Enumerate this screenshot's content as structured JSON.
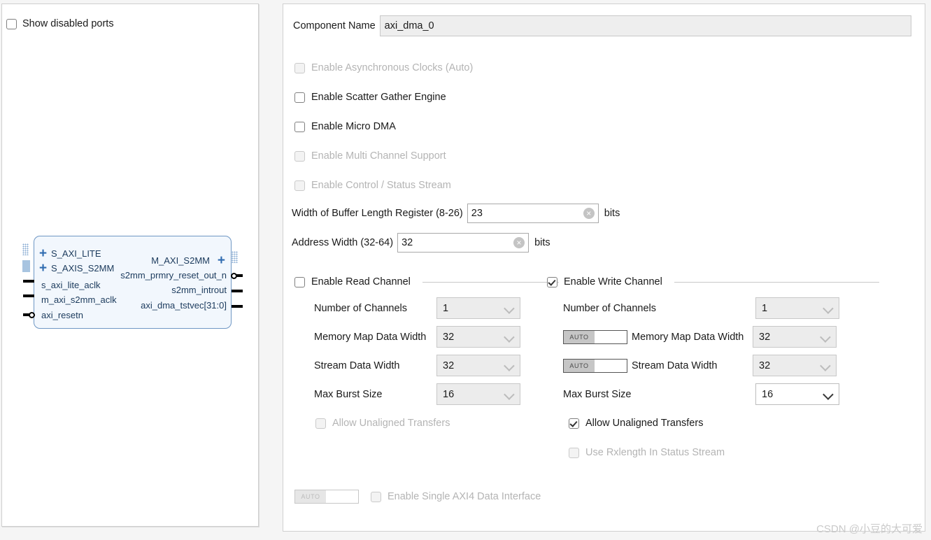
{
  "left_panel": {
    "show_disabled_ports": {
      "label": "Show disabled ports",
      "checked": false
    },
    "diagram": {
      "name": "axi_dma_0-block-symbol",
      "left_bus_ports": [
        "S_AXI_LITE",
        "S_AXIS_S2MM"
      ],
      "left_signal_ports": [
        "s_axi_lite_aclk",
        "m_axi_s2mm_aclk",
        "axi_resetn"
      ],
      "right_bus_ports": [
        "M_AXI_S2MM"
      ],
      "right_signal_ports": [
        "s2mm_prmry_reset_out_n",
        "s2mm_introut",
        "axi_dma_tstvec[31:0]"
      ],
      "plus_glyph": "+"
    }
  },
  "form": {
    "component_name": {
      "label": "Component Name",
      "value": "axi_dma_0"
    },
    "options": [
      {
        "label": "Enable Asynchronous Clocks (Auto)",
        "checked": false,
        "enabled": false
      },
      {
        "label": "Enable Scatter Gather Engine",
        "checked": false,
        "enabled": true
      },
      {
        "label": "Enable Micro DMA",
        "checked": false,
        "enabled": true
      },
      {
        "label": "Enable Multi Channel Support",
        "checked": false,
        "enabled": false
      },
      {
        "label": "Enable Control / Status Stream",
        "checked": false,
        "enabled": false
      }
    ],
    "numeric_fields": [
      {
        "label": "Width of Buffer Length Register (8-26)",
        "value": "23",
        "unit": "bits",
        "clear_icon": "×"
      },
      {
        "label": "Address Width (32-64)",
        "value": "32",
        "unit": "bits",
        "clear_icon": "×"
      }
    ],
    "read_channel": {
      "title": "Enable Read Channel",
      "checked": false,
      "fields": [
        {
          "label": "Number of Channels",
          "value": "1",
          "enabled": false,
          "auto": null
        },
        {
          "label": "Memory Map Data Width",
          "value": "32",
          "enabled": false,
          "auto": null
        },
        {
          "label": "Stream Data Width",
          "value": "32",
          "enabled": false,
          "auto": null
        },
        {
          "label": "Max Burst Size",
          "value": "16",
          "enabled": false,
          "auto": null
        }
      ],
      "extra_checkboxes": [
        {
          "label": "Allow Unaligned Transfers",
          "checked": false,
          "enabled": false
        }
      ]
    },
    "write_channel": {
      "title": "Enable Write Channel",
      "checked": true,
      "fields": [
        {
          "label": "Number of Channels",
          "value": "1",
          "enabled": false,
          "auto": null
        },
        {
          "label": "Memory Map Data Width",
          "value": "32",
          "enabled": false,
          "auto": "AUTO"
        },
        {
          "label": "Stream Data Width",
          "value": "32",
          "enabled": false,
          "auto": "AUTO"
        },
        {
          "label": "Max Burst Size",
          "value": "16",
          "enabled": true,
          "auto": null
        }
      ],
      "extra_checkboxes": [
        {
          "label": "Allow Unaligned Transfers",
          "checked": true,
          "enabled": true
        },
        {
          "label": "Use Rxlength In Status Stream",
          "checked": false,
          "enabled": false
        }
      ]
    },
    "bottom_option": {
      "auto_label": "AUTO",
      "label": "Enable Single AXI4 Data Interface",
      "checked": false,
      "enabled": false
    }
  },
  "watermark": "CSDN @小豆的大可爱",
  "colors": {
    "panel_background": "#ffffff",
    "page_background": "#f5f5f5",
    "symbol_fill": "#f2f7fd",
    "symbol_border": "#6f97c4",
    "bus_accent": "#2f6bb0",
    "disabled_text": "#b4b4b4",
    "text": "#1a1a1a"
  }
}
